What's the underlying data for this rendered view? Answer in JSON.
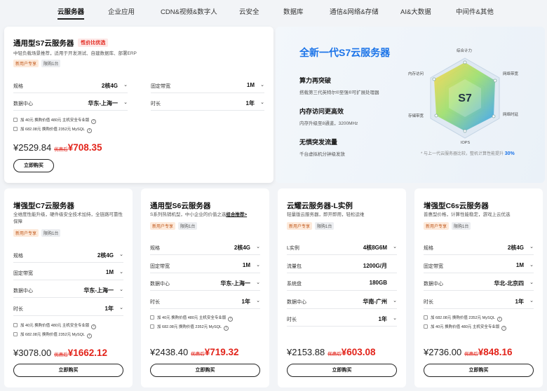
{
  "tabs": [
    "云服务器",
    "企业应用",
    "CDN&视频&数字人",
    "云安全",
    "数据库",
    "通信&网络&存储",
    "AI&大数据",
    "中间件&其他"
  ],
  "active_tab": "云服务器",
  "s7": {
    "title": "通用型S7云服务器",
    "hot": "性价比优选",
    "desc": "中轻负载场景推荐，适用于开发测试、自建数据库、部署ERP",
    "tag_new": "新用户专享",
    "tag_limit": "限购1台",
    "rows": [
      {
        "label": "规格",
        "value": "2核4G"
      },
      {
        "label": "数据中心",
        "value": "华东-上海一"
      },
      {
        "label": "固定带宽",
        "value": "1M"
      },
      {
        "label": "时长",
        "value": "1年"
      }
    ],
    "opts": [
      "加 40元 换购价值 480元 主机安全专业版",
      "加 682.08元 换购价值 2352元 MySQL"
    ],
    "price_orig": "¥2529.84",
    "price_label": "优惠后",
    "price_disc": "¥708.35",
    "buy": "立即购买"
  },
  "hero": {
    "title": "全新一代S7云服务器",
    "features": [
      {
        "title": "算力再突破",
        "desc": "搭载第三代英特尔®至强®可扩展处理器"
      },
      {
        "title": "内存访问更高效",
        "desc": "内存升级至8通道，3200MHz"
      },
      {
        "title": "无惧突发流量",
        "desc": "千台虚拟机分钟级发放"
      }
    ],
    "radar_center": "S7",
    "radar_labels": [
      "综合计力",
      "网络带宽",
      "网络时延",
      "IOPS",
      "存储带宽",
      "内存访问"
    ],
    "footnote": "* 与上一代云服务器比较，整机计算性能提升",
    "footnote_value": "30%",
    "colors": {
      "accent": "#1a73e8"
    }
  },
  "cards": [
    {
      "title": "增强型C7云服务器",
      "desc": "全维度性能升级，硬件级安全技术加持，全链路可靠性保障",
      "link": "",
      "tag_new": "新用户专享",
      "tag_limit": "限购1台",
      "rows": [
        {
          "label": "规格",
          "value": "2核4G"
        },
        {
          "label": "固定带宽",
          "value": "1M"
        },
        {
          "label": "数据中心",
          "value": "华东-上海一"
        },
        {
          "label": "时长",
          "value": "1年"
        }
      ],
      "opts": [
        "加 40元 换购价值 480元 主机安全专业版",
        "加 682.08元 换购价值 2352元 MySQL"
      ],
      "price_orig": "¥3078.00",
      "price_label": "优惠后",
      "price_disc": "¥1662.12",
      "buy": "立即购买"
    },
    {
      "title": "通用型S6云服务器",
      "desc": "S系列热销机型，中小企业的价值之选",
      "link": "组合推荐>",
      "tag_new": "新用户专享",
      "tag_limit": "限购1台",
      "rows": [
        {
          "label": "规格",
          "value": "2核4G"
        },
        {
          "label": "固定带宽",
          "value": "1M"
        },
        {
          "label": "数据中心",
          "value": "华东-上海一"
        },
        {
          "label": "时长",
          "value": "1年"
        }
      ],
      "opts": [
        "加 40元 换购价值 480元 主机安全专业版",
        "加 682.08元 换购价值 2352元 MySQL"
      ],
      "price_orig": "¥2438.40",
      "price_label": "优惠后",
      "price_disc": "¥719.32",
      "buy": "立即购买"
    },
    {
      "title": "云耀云服务器-L实例",
      "desc": "轻量版云服务器，即开即用，轻松运维",
      "link": "",
      "tag_new": "新用户专享",
      "tag_limit": "限购1台",
      "rows": [
        {
          "label": "L实例",
          "value": "4核8G6M"
        },
        {
          "label": "流量包",
          "value": "1200G/月"
        },
        {
          "label": "系统盘",
          "value": "180GB"
        },
        {
          "label": "数据中心",
          "value": "华南-广州"
        },
        {
          "label": "时长",
          "value": "1年"
        }
      ],
      "opts": [],
      "price_orig": "¥2153.88",
      "price_label": "优惠后",
      "price_disc": "¥603.08",
      "buy": "立即购买"
    },
    {
      "title": "增强型C6s云服务器",
      "desc": "普惠型价格，计算性能稳定，游戏上云优选",
      "link": "",
      "tag_new": "新用户专享",
      "tag_limit": "限购1台",
      "rows": [
        {
          "label": "规格",
          "value": "2核4G"
        },
        {
          "label": "固定带宽",
          "value": "1M"
        },
        {
          "label": "数据中心",
          "value": "华北-北京四"
        },
        {
          "label": "时长",
          "value": "1年"
        }
      ],
      "opts": [
        "加 682.08元 换购价值 2352元 MySQL",
        "加 40元 换购价值 480元 主机安全专业版"
      ],
      "price_orig": "¥2736.00",
      "price_label": "优惠后",
      "price_disc": "¥848.16",
      "buy": "立即购买"
    }
  ]
}
